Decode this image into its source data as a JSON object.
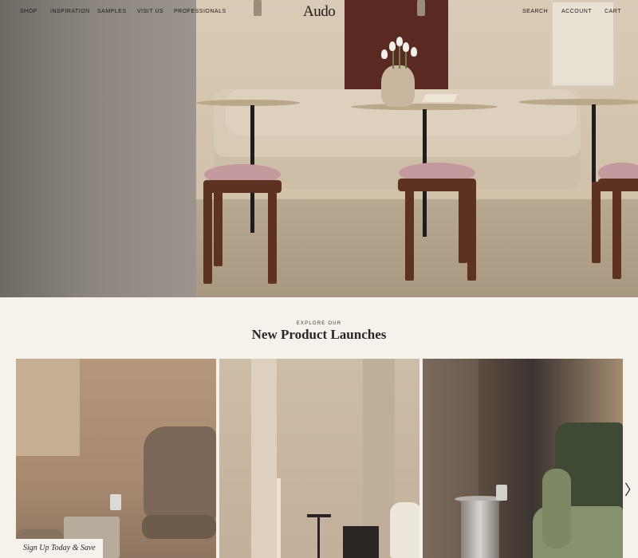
{
  "nav": {
    "left_items": [
      "SHOP",
      "INSPIRATION",
      "SAMPLES",
      "VISIT US",
      "PROFESSIONALS"
    ],
    "logo": "Audo",
    "right_items": [
      "SEARCH",
      "ACCOUNT",
      "CART"
    ]
  },
  "hero": {
    "image": "hero-dining-scene"
  },
  "launches": {
    "eyebrow": "EXPLORE OUR",
    "title": "New Product Launches",
    "cards": [
      {
        "image": "lounge-chair-sheepskin"
      },
      {
        "image": "interior-side-table"
      },
      {
        "image": "green-lounge-chair"
      }
    ],
    "next_icon": "chevron-right-icon"
  },
  "signup": {
    "label": "Sign Up Today & Save"
  },
  "colors": {
    "background": "#f5f2ec",
    "text": "#2b2723",
    "accent_red": "#5a2a22",
    "stool_pink": "#c59a9f"
  }
}
